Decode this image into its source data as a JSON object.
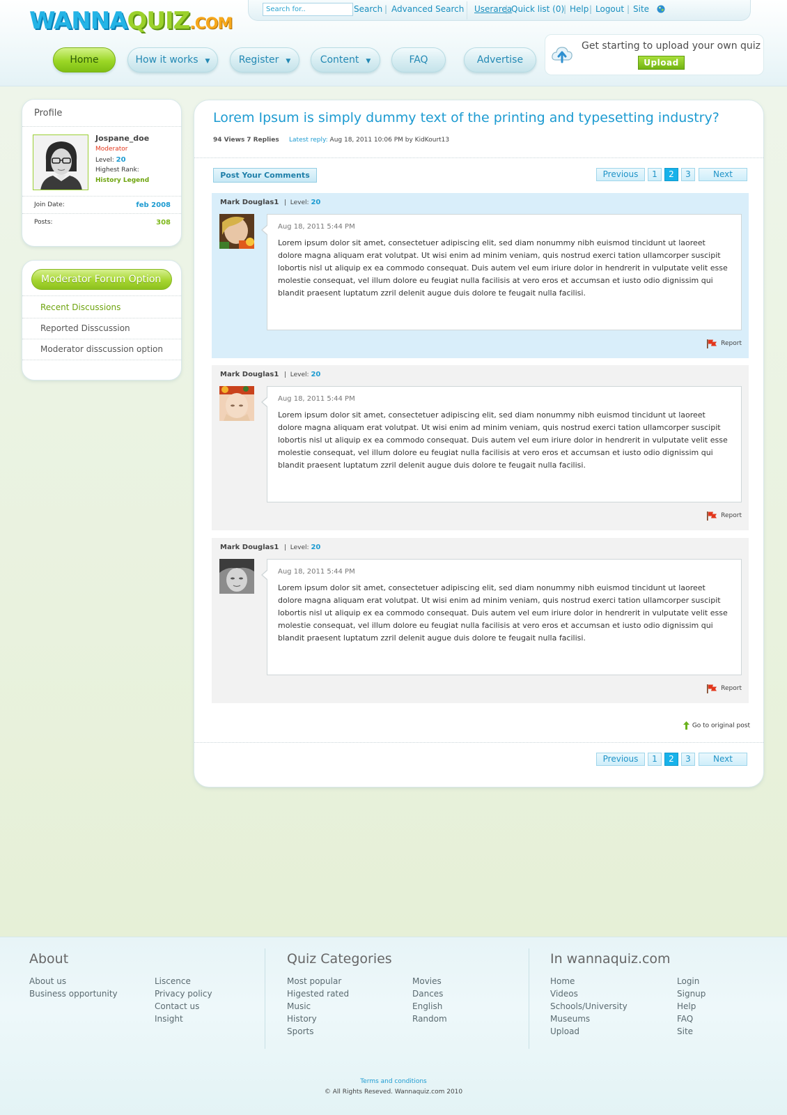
{
  "logo": {
    "part1": "WANNA",
    "part2": "QUIZ",
    "part3": ".COM"
  },
  "topbar": {
    "search_placeholder": "Search for..",
    "search": "Search",
    "advanced_search": "Advanced Search",
    "userarea": "Userarea",
    "quick_list": "Quick list (0)",
    "help": "Help",
    "logout": "Logout",
    "site": "Site",
    "separator": "|"
  },
  "nav": {
    "home": "Home",
    "how_it_works": "How it works",
    "register": "Register",
    "content": "Content",
    "faq": "FAQ",
    "advertise": "Advertise",
    "caret": "▼"
  },
  "upload": {
    "text": "Get starting to upload your own quiz",
    "button": "Upload"
  },
  "profile": {
    "title": "Profile",
    "username": "Jospane_doe",
    "role": "Moderator",
    "level_label": "Level:",
    "level": "20",
    "rank_label": "Highest Rank:",
    "rank": "History Legend",
    "join_label": "Join Date:",
    "join_date": "feb 2008",
    "posts_label": "Posts:",
    "posts": "308"
  },
  "moderator": {
    "title": "Moderator Forum Option",
    "items": [
      "Recent Discussions",
      "Reported Disscussion",
      "Moderator disscussion option"
    ]
  },
  "thread": {
    "title": "Lorem Ipsum is simply dummy text of the printing and typesetting industry?",
    "views": "94 Views",
    "replies": "7 Replies",
    "latest_label": "Latest reply:",
    "latest_value": "Aug 18, 2011 10:06 PM by KidKourt13",
    "post_comments": "Post Your Comments"
  },
  "pager": {
    "previous": "Previous",
    "pages": [
      "1",
      "2",
      "3"
    ],
    "current": "2",
    "next": "Next"
  },
  "posts": [
    {
      "author": "Mark Douglas1",
      "level_label": "Level:",
      "level": "20",
      "date": "Aug 18, 2011 5:44 PM",
      "body": "Lorem ipsum dolor sit amet, consectetuer adipiscing elit, sed diam nonummy nibh euismod tincidunt ut laoreet dolore magna aliquam erat volutpat. Ut wisi enim ad minim veniam, quis nostrud exerci tation ullamcorper suscipit lobortis nisl ut aliquip ex ea commodo consequat. Duis autem vel eum iriure dolor in hendrerit in vulputate velit esse molestie consequat, vel illum dolore eu feugiat nulla facilisis at vero eros et accumsan et iusto odio dignissim qui blandit praesent luptatum zzril delenit augue duis dolore te feugait nulla facilisi.",
      "report": "Report"
    },
    {
      "author": "Mark Douglas1",
      "level_label": "Level:",
      "level": "20",
      "date": "Aug 18, 2011 5:44 PM",
      "body": "Lorem ipsum dolor sit amet, consectetuer adipiscing elit, sed diam nonummy nibh euismod tincidunt ut laoreet dolore magna aliquam erat volutpat. Ut wisi enim ad minim veniam, quis nostrud exerci tation ullamcorper suscipit lobortis nisl ut aliquip ex ea commodo consequat. Duis autem vel eum iriure dolor in hendrerit in vulputate velit esse molestie consequat, vel illum dolore eu feugiat nulla facilisis at vero eros et accumsan et iusto odio dignissim qui blandit praesent luptatum zzril delenit augue duis dolore te feugait nulla facilisi.",
      "report": "Report"
    },
    {
      "author": "Mark Douglas1",
      "level_label": "Level:",
      "level": "20",
      "date": "Aug 18, 2011 5:44 PM",
      "body": "Lorem ipsum dolor sit amet, consectetuer adipiscing elit, sed diam nonummy nibh euismod tincidunt ut laoreet dolore magna aliquam erat volutpat. Ut wisi enim ad minim veniam, quis nostrud exerci tation ullamcorper suscipit lobortis nisl ut aliquip ex ea commodo consequat. Duis autem vel eum iriure dolor in hendrerit in vulputate velit esse molestie consequat, vel illum dolore eu feugiat nulla facilisis at vero eros et accumsan et iusto odio dignissim qui blandit praesent luptatum zzril delenit augue duis dolore te feugait nulla facilisi.",
      "report": "Report"
    }
  ],
  "go_original": "Go to original post",
  "footer": {
    "about": {
      "title": "About",
      "col1": [
        "About us",
        "Business opportunity"
      ],
      "col2": [
        "Liscence",
        "Privacy policy",
        "Contact us",
        "Insight"
      ]
    },
    "categories": {
      "title": "Quiz Categories",
      "col1": [
        "Most popular",
        "Higested rated",
        "Music",
        "History",
        "Sports"
      ],
      "col2": [
        "Movies",
        "Dances",
        "English",
        "Random"
      ]
    },
    "in_site": {
      "title": "In wannaquiz.com",
      "col1": [
        "Home",
        "Videos",
        "Schools/University",
        "Museums",
        "Upload"
      ],
      "col2": [
        "Login",
        "Signup",
        "Help",
        "FAQ",
        "Site"
      ]
    },
    "terms": "Terms and conditions",
    "copyright": "© All Rights Reseved. Wannaquiz.com 2010"
  },
  "icons": {
    "globe": "globe-icon",
    "cloud_upload": "cloud-upload-icon",
    "flag": "flag-icon",
    "arrow_up": "arrow-up-icon"
  },
  "colors": {
    "accent_blue": "#1d9bd1",
    "accent_green": "#8cc11d",
    "moderator_red": "#e2371c"
  }
}
